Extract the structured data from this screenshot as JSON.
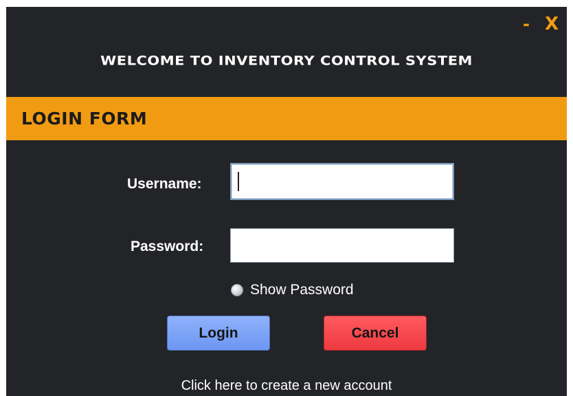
{
  "window": {
    "minimize_glyph": "-",
    "close_glyph": "X",
    "title": "WELCOME TO INVENTORY CONTROL SYSTEM"
  },
  "form_bar": {
    "label": "LOGIN FORM"
  },
  "fields": {
    "username_label": "Username:",
    "username_value": "",
    "password_label": "Password:",
    "password_value": ""
  },
  "show_password": {
    "label": "Show Password",
    "checked": false
  },
  "buttons": {
    "login": "Login",
    "cancel": "Cancel"
  },
  "links": {
    "create_account": "Click here to create a new account"
  },
  "colors": {
    "background": "#232427",
    "accent": "#f19b13",
    "login_button": "#7aa2f7",
    "cancel_button": "#f44a50"
  }
}
